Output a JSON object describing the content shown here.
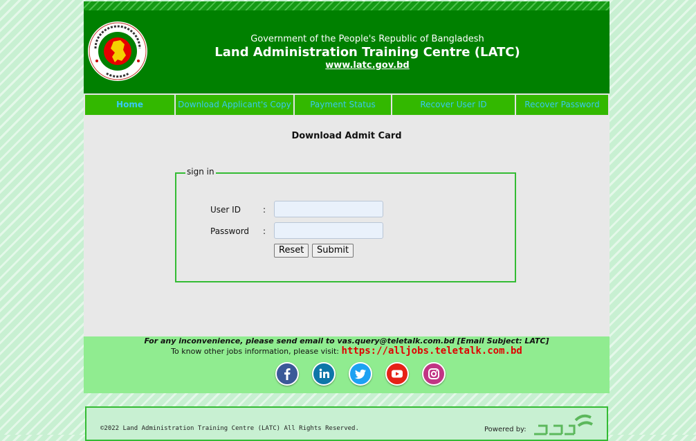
{
  "header": {
    "gov_line": "Government of the People's Republic of Bangladesh",
    "title": "Land Administration Training Centre (LATC)",
    "url": "www.latc.gov.bd",
    "logo_icon": "bangladesh-government-seal-icon"
  },
  "nav": {
    "items": [
      {
        "label": "Home"
      },
      {
        "label": "Download Applicant's Copy"
      },
      {
        "label": "Payment Status"
      },
      {
        "label": "Recover User ID"
      },
      {
        "label": "Recover Password"
      }
    ]
  },
  "main": {
    "title": "Download Admit Card",
    "form": {
      "legend": "sign in",
      "user_id_label": "User ID",
      "password_label": "Password",
      "colon": ":",
      "user_id_value": "",
      "password_value": "",
      "reset_label": "Reset",
      "submit_label": "Submit"
    }
  },
  "footer": {
    "notice": "For any inconvenience, please send email to vas.query@teletalk.com.bd  [Email Subject: LATC]",
    "jobs_prefix": "To know other jobs information, please visit:",
    "jobs_link": "https://alljobs.teletalk.com.bd",
    "social": [
      {
        "icon": "facebook-icon",
        "color": "#3b5998"
      },
      {
        "icon": "linkedin-icon",
        "color": "#0e76a8"
      },
      {
        "icon": "twitter-icon",
        "color": "#1da1f2"
      },
      {
        "icon": "youtube-icon",
        "color": "#e62117"
      },
      {
        "icon": "instagram-icon",
        "color": "#c13584"
      }
    ],
    "copyright": "©2022 Land Administration Training Centre (LATC) All Rights Reserved.",
    "powered_by": "Powered by:",
    "powered_logo_icon": "teletalk-logo-icon"
  },
  "colors": {
    "header_green": "#008000",
    "nav_green": "#33b800",
    "nav_text": "#37c8f2",
    "footer_green": "#90ec90",
    "link_red": "#e00000"
  }
}
